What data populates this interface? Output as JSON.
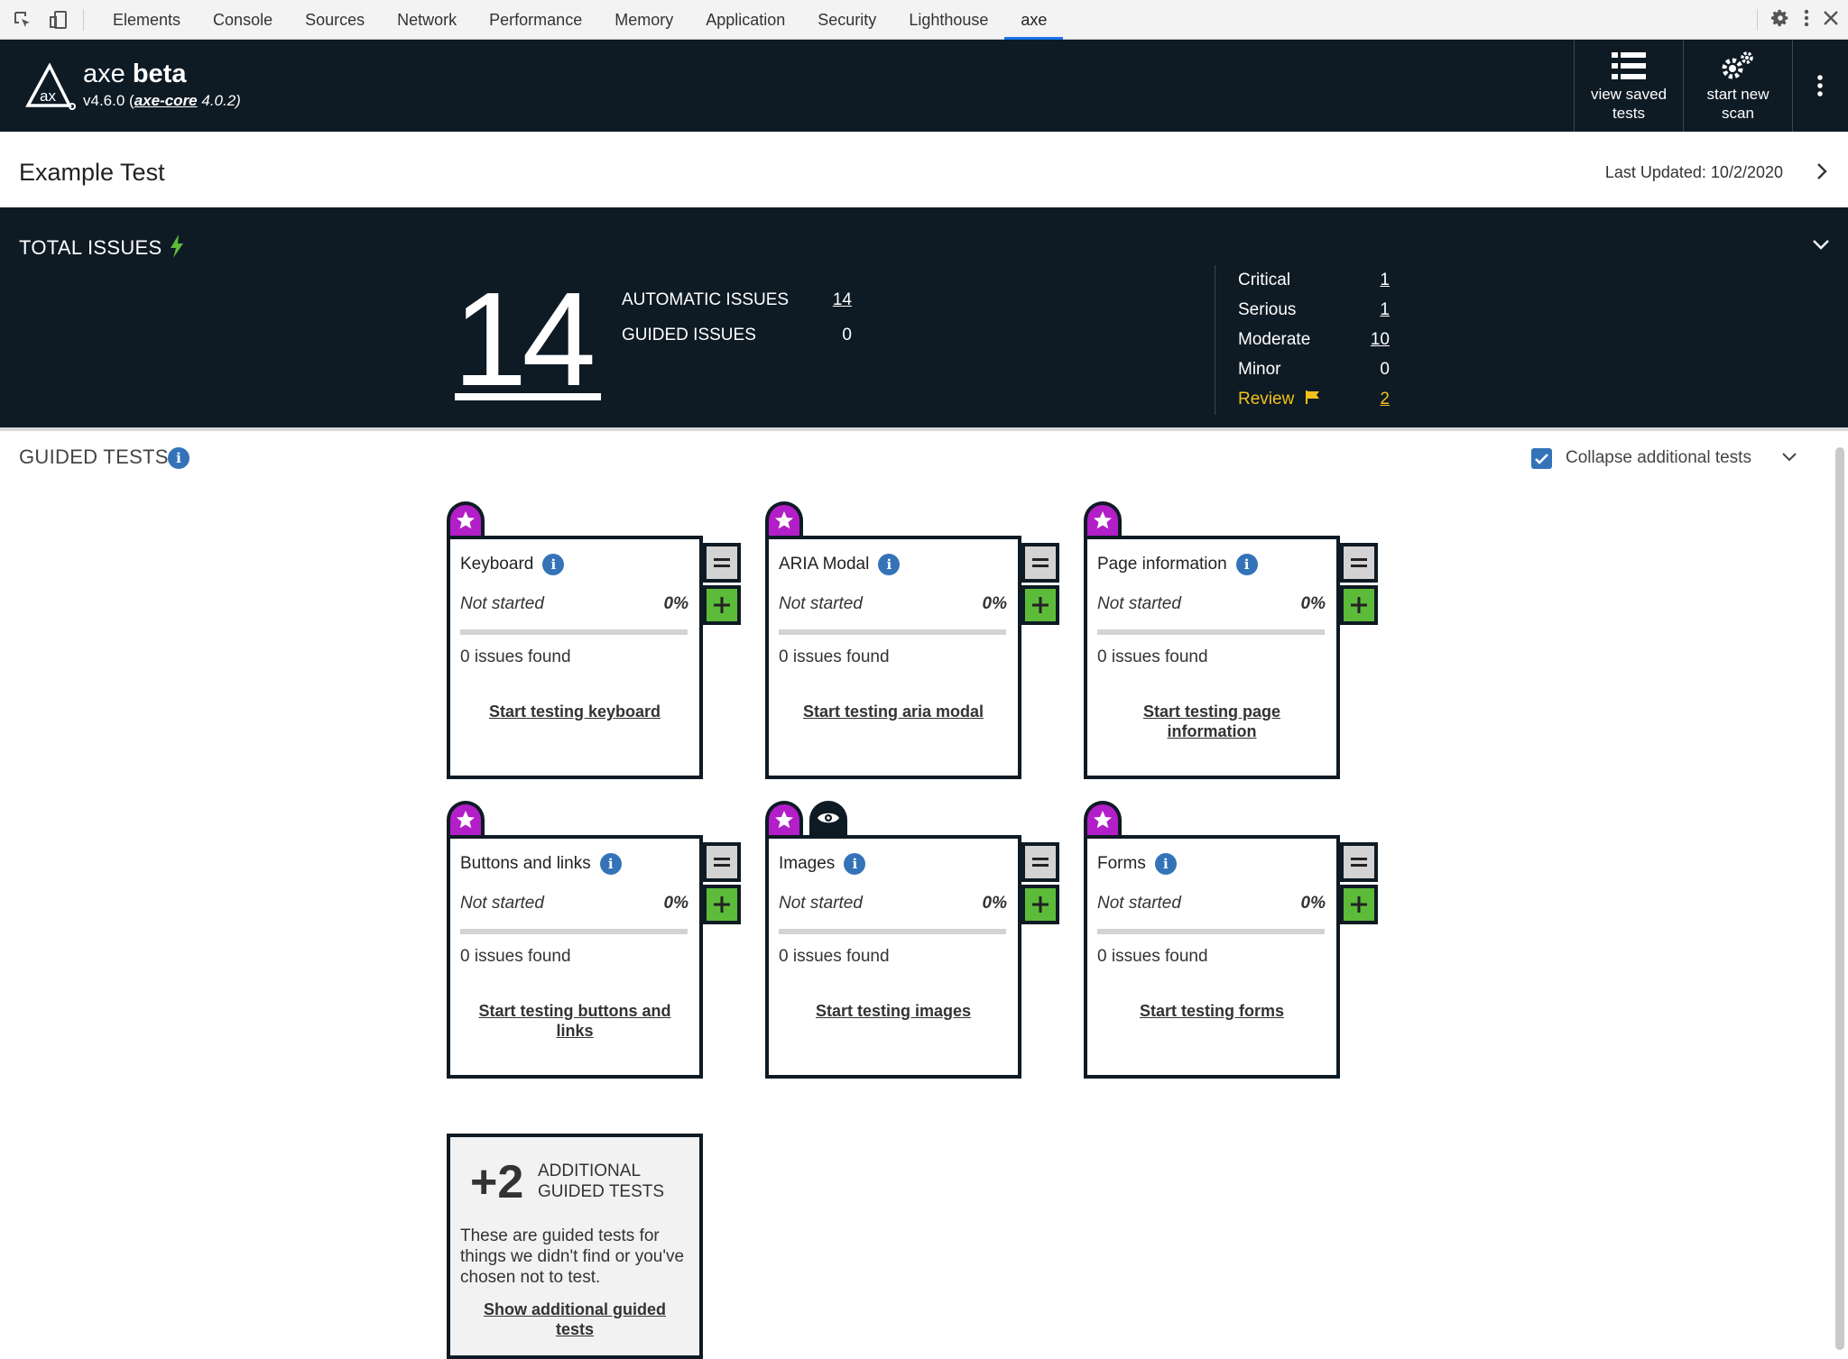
{
  "devtools": {
    "tabs": [
      "Elements",
      "Console",
      "Sources",
      "Network",
      "Performance",
      "Memory",
      "Application",
      "Security",
      "Lighthouse",
      "axe"
    ],
    "active_tab": "axe",
    "icons": [
      "inspect-element-icon",
      "device-toggle-icon",
      "settings-icon",
      "more-vertical-icon",
      "close-icon"
    ]
  },
  "header": {
    "brand_name": "axe",
    "brand_suffix": "beta",
    "version_prefix": "v4.6.0 (",
    "core_link": "axe-core",
    "version_suffix": " 4.0.2)",
    "view_saved_label": "view saved tests",
    "start_new_label": "start new scan"
  },
  "test": {
    "title": "Example Test",
    "last_updated": "Last Updated: 10/2/2020"
  },
  "total_issues": {
    "title": "TOTAL ISSUES",
    "total": "14",
    "automatic_label": "AUTOMATIC ISSUES",
    "automatic_value": "14",
    "guided_label": "GUIDED ISSUES",
    "guided_value": "0",
    "severity": [
      {
        "label": "Critical",
        "value": "1"
      },
      {
        "label": "Serious",
        "value": "1"
      },
      {
        "label": "Moderate",
        "value": "10"
      },
      {
        "label": "Minor",
        "value": "0"
      },
      {
        "label": "Review",
        "value": "2"
      }
    ],
    "colors": {
      "background": "#0e1a24",
      "review": "#f1c21b",
      "bolt": "#5dbb3a"
    }
  },
  "guided_tests": {
    "title": "GUIDED TESTS",
    "collapse_label": "Collapse additional tests",
    "collapse_checked": true,
    "cards": [
      {
        "title": "Keyboard",
        "status": "Not started",
        "percent": "0%",
        "issues": "0 issues found",
        "link": "Start testing keyboard"
      },
      {
        "title": "ARIA Modal",
        "status": "Not started",
        "percent": "0%",
        "issues": "0 issues found",
        "link": "Start testing aria modal"
      },
      {
        "title": "Page information",
        "status": "Not started",
        "percent": "0%",
        "issues": "0 issues found",
        "link": "Start testing page information"
      },
      {
        "title": "Buttons and links",
        "status": "Not started",
        "percent": "0%",
        "issues": "0 issues found",
        "link": "Start testing buttons and links"
      },
      {
        "title": "Images",
        "status": "Not started",
        "percent": "0%",
        "issues": "0 issues found",
        "link": "Start testing images"
      },
      {
        "title": "Forms",
        "status": "Not started",
        "percent": "0%",
        "issues": "0 issues found",
        "link": "Start testing forms"
      }
    ],
    "additional": {
      "count": "+2",
      "label": "ADDITIONAL GUIDED TESTS",
      "description": "These are guided tests for things we didn't find or you've chosen not to test.",
      "link": "Show additional guided tests"
    },
    "colors": {
      "star_tab": "#b21ec8",
      "plus": "#5dbb3a",
      "minus": "#d3d3d3",
      "info": "#3573b9"
    }
  }
}
